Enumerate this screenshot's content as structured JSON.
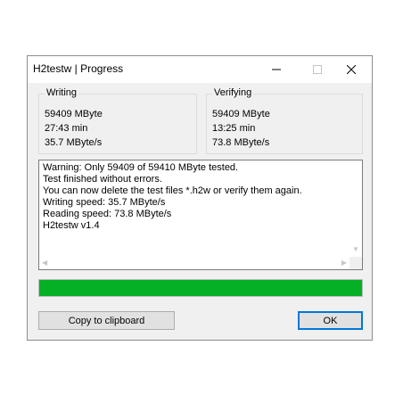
{
  "window": {
    "title": "H2testw | Progress"
  },
  "writing": {
    "title": "Writing",
    "size": "59409 MByte",
    "time": "27:43 min",
    "speed": "35.7 MByte/s"
  },
  "verifying": {
    "title": "Verifying",
    "size": "59409 MByte",
    "time": "13:25 min",
    "speed": "73.8 MByte/s"
  },
  "log": {
    "lines": [
      "Warning: Only 59409 of 59410 MByte tested.",
      "Test finished without errors.",
      "You can now delete the test files *.h2w or verify them again.",
      "Writing speed: 35.7 MByte/s",
      "Reading speed: 73.8 MByte/s",
      "H2testw v1.4"
    ]
  },
  "progress": {
    "fraction": 1.0,
    "color": "#06b025"
  },
  "buttons": {
    "copy_label": "Copy to clipboard",
    "ok_label": "OK"
  },
  "icons": {
    "minimize": "minimize-icon",
    "maximize": "maximize-icon",
    "close": "close-icon"
  }
}
